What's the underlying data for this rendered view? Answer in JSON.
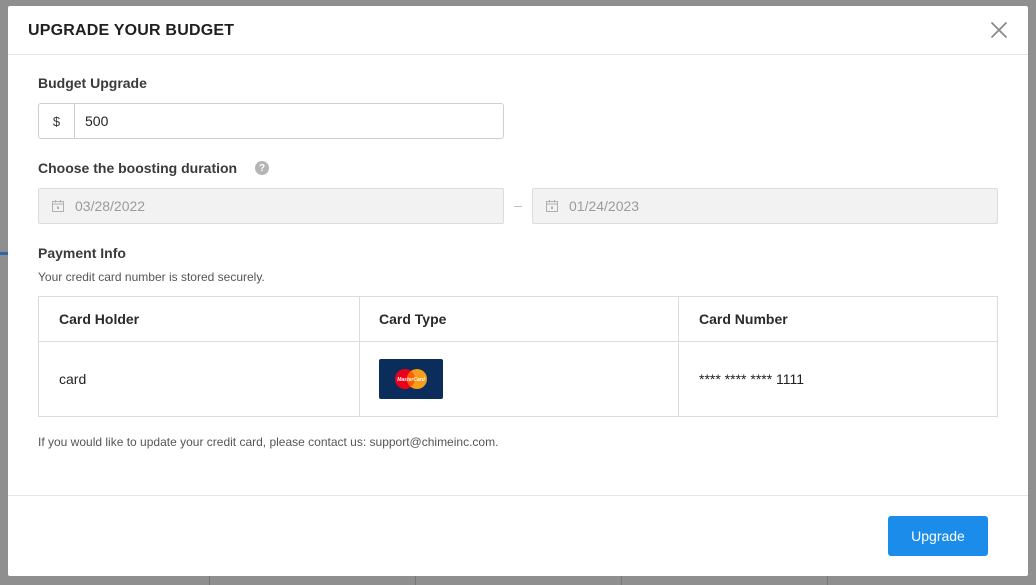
{
  "modal": {
    "title": "UPGRADE YOUR BUDGET",
    "close_icon": "close-icon"
  },
  "budget": {
    "label": "Budget Upgrade",
    "currency_symbol": "$",
    "value": "500"
  },
  "duration": {
    "label": "Choose the boosting duration",
    "help_icon": "question-circle-icon",
    "help_glyph": "?",
    "start_date": "03/28/2022",
    "end_date": "01/24/2023",
    "separator": "–",
    "calendar_icon": "calendar-icon"
  },
  "payment": {
    "label": "Payment Info",
    "subtext": "Your credit card number is stored securely.",
    "table": {
      "headers": [
        "Card Holder",
        "Card Type",
        "Card Number"
      ],
      "rows": [
        {
          "holder": "card",
          "type_icon": "mastercard-icon",
          "number": "**** **** **** 1111"
        }
      ]
    },
    "note": "If you would like to update your credit card, please contact us: support@chimeinc.com."
  },
  "footer": {
    "upgrade_label": "Upgrade"
  },
  "colors": {
    "primary": "#1b8ce9",
    "card_bg": "#0b2d5c",
    "overlay": "#8f8f8f"
  }
}
